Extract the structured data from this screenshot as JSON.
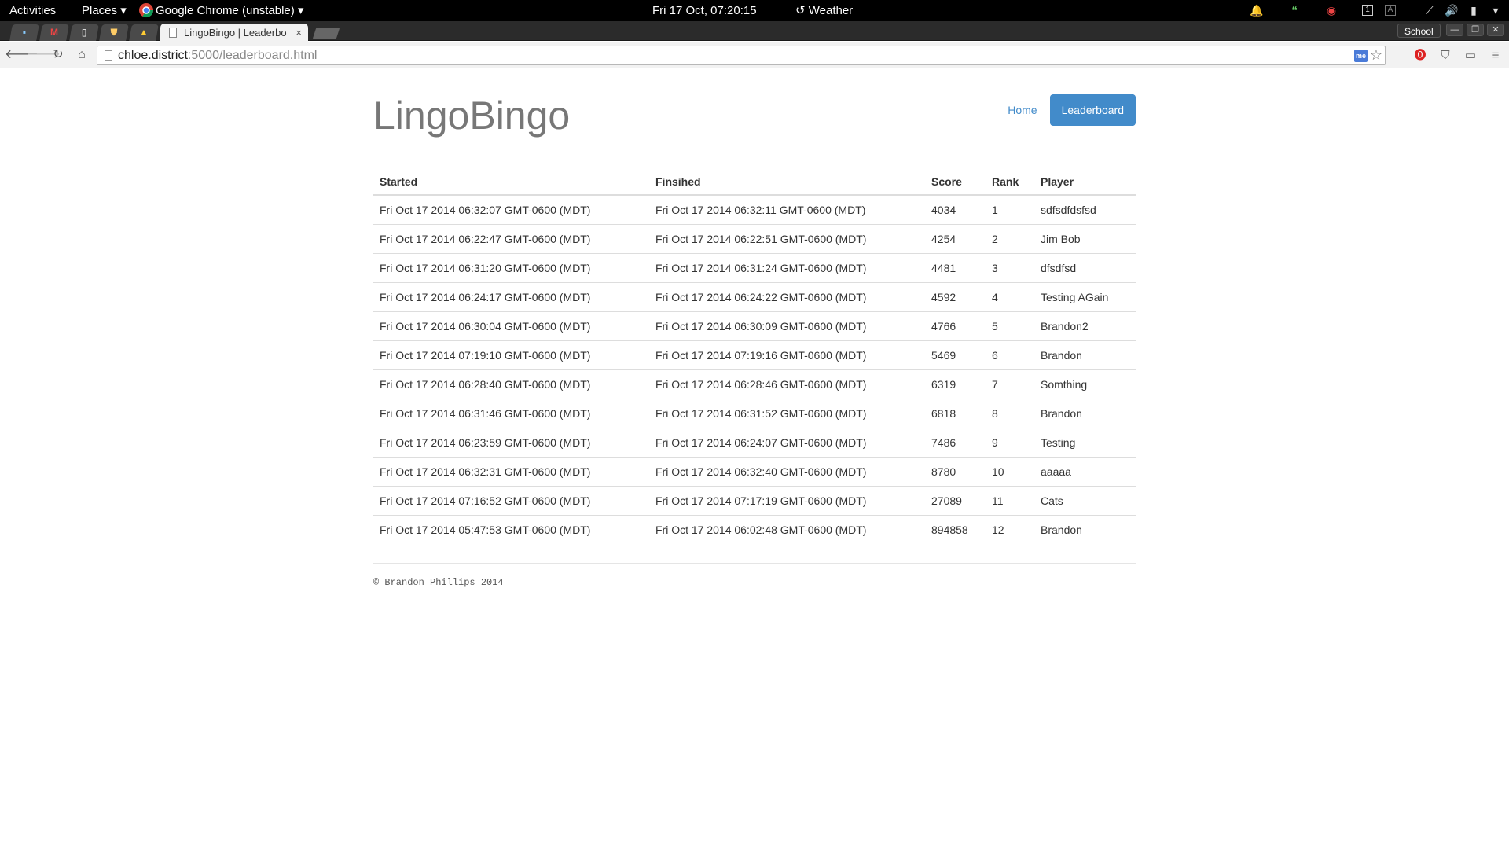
{
  "topbar": {
    "activities": "Activities",
    "places": "Places ▾",
    "app_menu": "Google Chrome (unstable) ▾",
    "clock": "Fri 17 Oct, 07:20:15",
    "weather": "Weather"
  },
  "browser": {
    "tab_title": "LingoBingo | Leaderbo",
    "tab_close": "×",
    "profile": "School",
    "url_host": "chloe.district",
    "url_rest": ":5000/leaderboard.html",
    "me_badge": "me"
  },
  "site": {
    "brand": "LingoBingo",
    "nav": {
      "home": "Home",
      "leaderboard": "Leaderboard"
    },
    "footer": "© Brandon Phillips 2014"
  },
  "table": {
    "headers": {
      "started": "Started",
      "finished": "Finsihed",
      "score": "Score",
      "rank": "Rank",
      "player": "Player"
    },
    "rows": [
      {
        "started": "Fri Oct 17 2014 06:32:07 GMT-0600 (MDT)",
        "finished": "Fri Oct 17 2014 06:32:11 GMT-0600 (MDT)",
        "score": "4034",
        "rank": "1",
        "player": "sdfsdfdsfsd"
      },
      {
        "started": "Fri Oct 17 2014 06:22:47 GMT-0600 (MDT)",
        "finished": "Fri Oct 17 2014 06:22:51 GMT-0600 (MDT)",
        "score": "4254",
        "rank": "2",
        "player": "Jim Bob"
      },
      {
        "started": "Fri Oct 17 2014 06:31:20 GMT-0600 (MDT)",
        "finished": "Fri Oct 17 2014 06:31:24 GMT-0600 (MDT)",
        "score": "4481",
        "rank": "3",
        "player": "dfsdfsd"
      },
      {
        "started": "Fri Oct 17 2014 06:24:17 GMT-0600 (MDT)",
        "finished": "Fri Oct 17 2014 06:24:22 GMT-0600 (MDT)",
        "score": "4592",
        "rank": "4",
        "player": "Testing AGain"
      },
      {
        "started": "Fri Oct 17 2014 06:30:04 GMT-0600 (MDT)",
        "finished": "Fri Oct 17 2014 06:30:09 GMT-0600 (MDT)",
        "score": "4766",
        "rank": "5",
        "player": "Brandon2"
      },
      {
        "started": "Fri Oct 17 2014 07:19:10 GMT-0600 (MDT)",
        "finished": "Fri Oct 17 2014 07:19:16 GMT-0600 (MDT)",
        "score": "5469",
        "rank": "6",
        "player": "Brandon"
      },
      {
        "started": "Fri Oct 17 2014 06:28:40 GMT-0600 (MDT)",
        "finished": "Fri Oct 17 2014 06:28:46 GMT-0600 (MDT)",
        "score": "6319",
        "rank": "7",
        "player": "Somthing"
      },
      {
        "started": "Fri Oct 17 2014 06:31:46 GMT-0600 (MDT)",
        "finished": "Fri Oct 17 2014 06:31:52 GMT-0600 (MDT)",
        "score": "6818",
        "rank": "8",
        "player": "Brandon"
      },
      {
        "started": "Fri Oct 17 2014 06:23:59 GMT-0600 (MDT)",
        "finished": "Fri Oct 17 2014 06:24:07 GMT-0600 (MDT)",
        "score": "7486",
        "rank": "9",
        "player": "Testing"
      },
      {
        "started": "Fri Oct 17 2014 06:32:31 GMT-0600 (MDT)",
        "finished": "Fri Oct 17 2014 06:32:40 GMT-0600 (MDT)",
        "score": "8780",
        "rank": "10",
        "player": "aaaaa"
      },
      {
        "started": "Fri Oct 17 2014 07:16:52 GMT-0600 (MDT)",
        "finished": "Fri Oct 17 2014 07:17:19 GMT-0600 (MDT)",
        "score": "27089",
        "rank": "11",
        "player": "Cats"
      },
      {
        "started": "Fri Oct 17 2014 05:47:53 GMT-0600 (MDT)",
        "finished": "Fri Oct 17 2014 06:02:48 GMT-0600 (MDT)",
        "score": "894858",
        "rank": "12",
        "player": "Brandon"
      }
    ]
  },
  "colors": {
    "accent": "#428bca",
    "brand_text": "#777777",
    "topbar_bg": "#000000"
  }
}
